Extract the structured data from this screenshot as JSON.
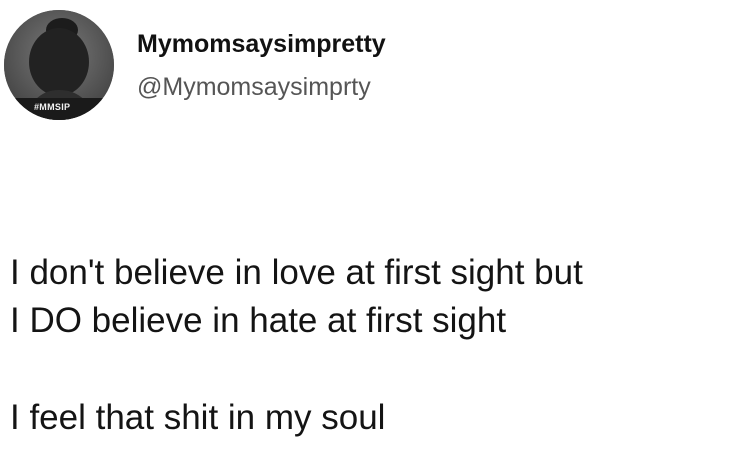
{
  "author": {
    "display_name": "Mymomsaysimpretty",
    "handle": "@Mymomsaysimprty",
    "avatar_tag": "#MMSIP",
    "avatar_icon": "profile-photo-avatar"
  },
  "tweet": {
    "lines": [
      "I don't believe in love at first sight but",
      "I DO believe in hate at first sight",
      "I feel that shit in my soul"
    ]
  },
  "colors": {
    "text": "#141414",
    "handle": "#555555",
    "background": "#ffffff"
  }
}
